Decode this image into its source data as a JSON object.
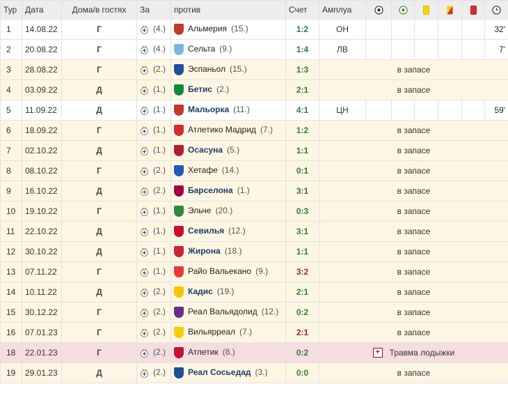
{
  "headers": {
    "tour": "Тур",
    "date": "Дата",
    "home": "Дома/в гостях",
    "za": "За",
    "against": "против",
    "score": "Счет",
    "position": "Амплуа"
  },
  "header_icons": [
    "goal-ball-icon",
    "assist-ball-icon",
    "yellow-card-icon",
    "second-yellow-card-icon",
    "red-card-icon",
    "clock-icon"
  ],
  "colors": {
    "played_row": "#ffffff",
    "bench_row": "#fdf6e3",
    "injury_row": "#f6dde2",
    "score": "#2e7d32",
    "opponent_bold": "#1d3f66"
  },
  "rows": [
    {
      "tour": "1",
      "date": "14.08.22",
      "home": "Г",
      "za_rank": "(4.)",
      "opponent": "Альмерия",
      "opp_rank": "(15.)",
      "opp_bold": false,
      "score": "1:2",
      "position": "ОН",
      "minutes": "32'",
      "status": "played",
      "note": "",
      "crest_color": "#c0392b"
    },
    {
      "tour": "2",
      "date": "20.08.22",
      "home": "Г",
      "za_rank": "(4.)",
      "opponent": "Сельта",
      "opp_rank": "(9.)",
      "opp_bold": false,
      "score": "1:4",
      "position": "ЛВ",
      "minutes": "7'",
      "status": "played",
      "note": "",
      "crest_color": "#7fb3e0"
    },
    {
      "tour": "3",
      "date": "28.08.22",
      "home": "Г",
      "za_rank": "(2.)",
      "opponent": "Эспаньол",
      "opp_rank": "(15.)",
      "opp_bold": false,
      "score": "1:3",
      "position": "",
      "minutes": "",
      "status": "bench",
      "note": "в запасе",
      "crest_color": "#1f4e9c"
    },
    {
      "tour": "4",
      "date": "03.09.22",
      "home": "Д",
      "za_rank": "(1.)",
      "opponent": "Бетис",
      "opp_rank": "(2.)",
      "opp_bold": true,
      "score": "2:1",
      "position": "",
      "minutes": "",
      "status": "bench",
      "note": "в запасе",
      "crest_color": "#0f8a3c"
    },
    {
      "tour": "5",
      "date": "11.09.22",
      "home": "Д",
      "za_rank": "(1.)",
      "opponent": "Мальорка",
      "opp_rank": "(11.)",
      "opp_bold": true,
      "score": "4:1",
      "position": "ЦН",
      "minutes": "59'",
      "status": "played",
      "note": "",
      "crest_color": "#c0392b"
    },
    {
      "tour": "6",
      "date": "18.09.22",
      "home": "Г",
      "za_rank": "(1.)",
      "opponent": "Атлетико Мадрид",
      "opp_rank": "(7.)",
      "opp_bold": false,
      "score": "1:2",
      "position": "",
      "minutes": "",
      "status": "bench",
      "note": "в запасе",
      "crest_color": "#d22b2b"
    },
    {
      "tour": "7",
      "date": "02.10.22",
      "home": "Д",
      "za_rank": "(1.)",
      "opponent": "Осасуна",
      "opp_rank": "(5.)",
      "opp_bold": true,
      "score": "1:1",
      "position": "",
      "minutes": "",
      "status": "bench",
      "note": "в запасе",
      "crest_color": "#b0202a"
    },
    {
      "tour": "8",
      "date": "08.10.22",
      "home": "Г",
      "za_rank": "(2.)",
      "opponent": "Хетафе",
      "opp_rank": "(14.)",
      "opp_bold": false,
      "score": "0:1",
      "position": "",
      "minutes": "",
      "status": "bench",
      "note": "в запасе",
      "crest_color": "#1e5bb8"
    },
    {
      "tour": "9",
      "date": "16.10.22",
      "home": "Д",
      "za_rank": "(2.)",
      "opponent": "Барселона",
      "opp_rank": "(1.)",
      "opp_bold": true,
      "score": "3:1",
      "position": "",
      "minutes": "",
      "status": "bench",
      "note": "в запасе",
      "crest_color": "#a50044"
    },
    {
      "tour": "10",
      "date": "19.10.22",
      "home": "Г",
      "za_rank": "(1.)",
      "opponent": "Эльче",
      "opp_rank": "(20.)",
      "opp_bold": false,
      "score": "0:3",
      "position": "",
      "minutes": "",
      "status": "bench",
      "note": "в запасе",
      "crest_color": "#2e8b3c"
    },
    {
      "tour": "11",
      "date": "22.10.22",
      "home": "Д",
      "za_rank": "(1.)",
      "opponent": "Севилья",
      "opp_rank": "(12.)",
      "opp_bold": true,
      "score": "3:1",
      "position": "",
      "minutes": "",
      "status": "bench",
      "note": "в запасе",
      "crest_color": "#c8102e"
    },
    {
      "tour": "12",
      "date": "30.10.22",
      "home": "Д",
      "za_rank": "(1.)",
      "opponent": "Жирона",
      "opp_rank": "(18.)",
      "opp_bold": true,
      "score": "1:1",
      "position": "",
      "minutes": "",
      "status": "bench",
      "note": "в запасе",
      "crest_color": "#cd2534"
    },
    {
      "tour": "13",
      "date": "07.11.22",
      "home": "Г",
      "za_rank": "(1.)",
      "opponent": "Райо Вальекано",
      "opp_rank": "(9.)",
      "opp_bold": false,
      "score": "3:2",
      "position": "",
      "minutes": "",
      "status": "bench",
      "note": "в запасе",
      "crest_color": "#e53935",
      "score_red": true
    },
    {
      "tour": "14",
      "date": "10.11.22",
      "home": "Д",
      "za_rank": "(2.)",
      "opponent": "Кадис",
      "opp_rank": "(19.)",
      "opp_bold": true,
      "score": "2:1",
      "position": "",
      "minutes": "",
      "status": "bench",
      "note": "в запасе",
      "crest_color": "#f2c500"
    },
    {
      "tour": "15",
      "date": "30.12.22",
      "home": "Г",
      "za_rank": "(2.)",
      "opponent": "Реал Вальядолид",
      "opp_rank": "(12.)",
      "opp_bold": false,
      "score": "0:2",
      "position": "",
      "minutes": "",
      "status": "bench",
      "note": "в запасе",
      "crest_color": "#6a2c8c"
    },
    {
      "tour": "16",
      "date": "07.01.23",
      "home": "Г",
      "za_rank": "(2.)",
      "opponent": "Вильярреал",
      "opp_rank": "(7.)",
      "opp_bold": false,
      "score": "2:1",
      "position": "",
      "minutes": "",
      "status": "bench",
      "note": "в запасе",
      "crest_color": "#f4d000",
      "score_red": true
    },
    {
      "tour": "18",
      "date": "22.01.23",
      "home": "Г",
      "za_rank": "(2.)",
      "opponent": "Атлетик",
      "opp_rank": "(8.)",
      "opp_bold": false,
      "score": "0:2",
      "position": "",
      "minutes": "",
      "status": "injury",
      "note": "Травма лодыжки",
      "crest_color": "#c8102e"
    },
    {
      "tour": "19",
      "date": "29.01.23",
      "home": "Д",
      "za_rank": "(2.)",
      "opponent": "Реал Сосьедад",
      "opp_rank": "(3.)",
      "opp_bold": true,
      "score": "0:0",
      "position": "",
      "minutes": "",
      "status": "bench",
      "note": "в запасе",
      "crest_color": "#1d4f91"
    }
  ]
}
